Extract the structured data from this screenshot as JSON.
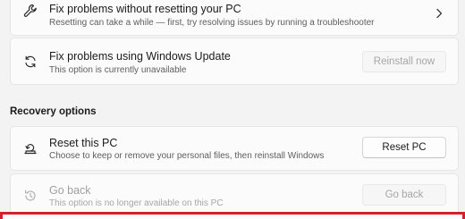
{
  "colors": {
    "background": "#f3f3f3",
    "card": "#fbfbfb",
    "highlight_border": "#d4202e"
  },
  "troubleshoot": {
    "title": "Fix problems without resetting your PC",
    "description": "Resetting can take a while — first, try resolving issues by running a troubleshooter",
    "icon": "wrench-icon",
    "chevron": "chevron-right-icon"
  },
  "windows_update": {
    "title": "Fix problems using Windows Update",
    "description": "This option is currently unavailable",
    "icon": "refresh-icon",
    "button_label": "Reinstall now",
    "button_enabled": false
  },
  "recovery_options": {
    "heading": "Recovery options",
    "reset": {
      "title": "Reset this PC",
      "description": "Choose to keep or remove your personal files, then reinstall Windows",
      "icon": "reset-pc-icon",
      "button_label": "Reset PC",
      "button_enabled": true
    },
    "go_back": {
      "title": "Go back",
      "description": "This option is no longer available on this PC",
      "icon": "history-icon",
      "button_label": "Go back",
      "button_enabled": false
    }
  }
}
